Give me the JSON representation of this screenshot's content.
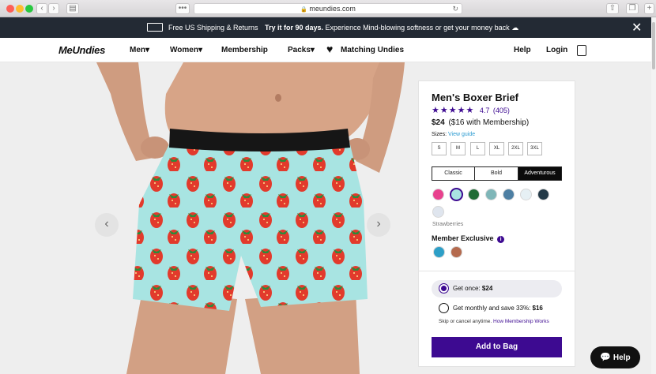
{
  "browser": {
    "url": "meundies.com"
  },
  "promo": {
    "shipping": "Free US Shipping & Returns",
    "trial_bold": "Try it for 90 days.",
    "trial_text": "Experience Mind-blowing softness or get your money back"
  },
  "header": {
    "logo": "MeUndies",
    "nav": [
      "Men",
      "Women",
      "Membership",
      "Packs",
      "Matching Undies"
    ],
    "help": "Help",
    "login": "Login"
  },
  "product": {
    "title": "Men's Boxer Brief",
    "rating": "4.7",
    "reviews": "(405)",
    "stars": 4.7,
    "price": "$24",
    "member_price": "($16 with Membership)",
    "sizes_label": "Sizes:",
    "view_guide": "View guide",
    "sizes": [
      "S",
      "M",
      "L",
      "XL",
      "2XL",
      "3XL"
    ],
    "styles": [
      "Classic",
      "Bold",
      "Adventurous"
    ],
    "selected_style": "Adventurous",
    "selected_print": "Strawberries",
    "member_exclusive": "Member Exclusive",
    "purchase": {
      "once": "Get once:",
      "once_price": "$24",
      "monthly": "Get monthly and save 33%:",
      "monthly_price": "$16",
      "note": "Skip or cancel anytime.",
      "note_link": "How Membership Works"
    },
    "add_to_bag": "Add to Bag"
  },
  "chat": {
    "label": "Help"
  },
  "colors": {
    "accent": "#3d0a91",
    "link": "#2c9bd1",
    "star": "#3d0a91",
    "promo_bg": "#232a34",
    "button_bg": "#3d0a91"
  }
}
